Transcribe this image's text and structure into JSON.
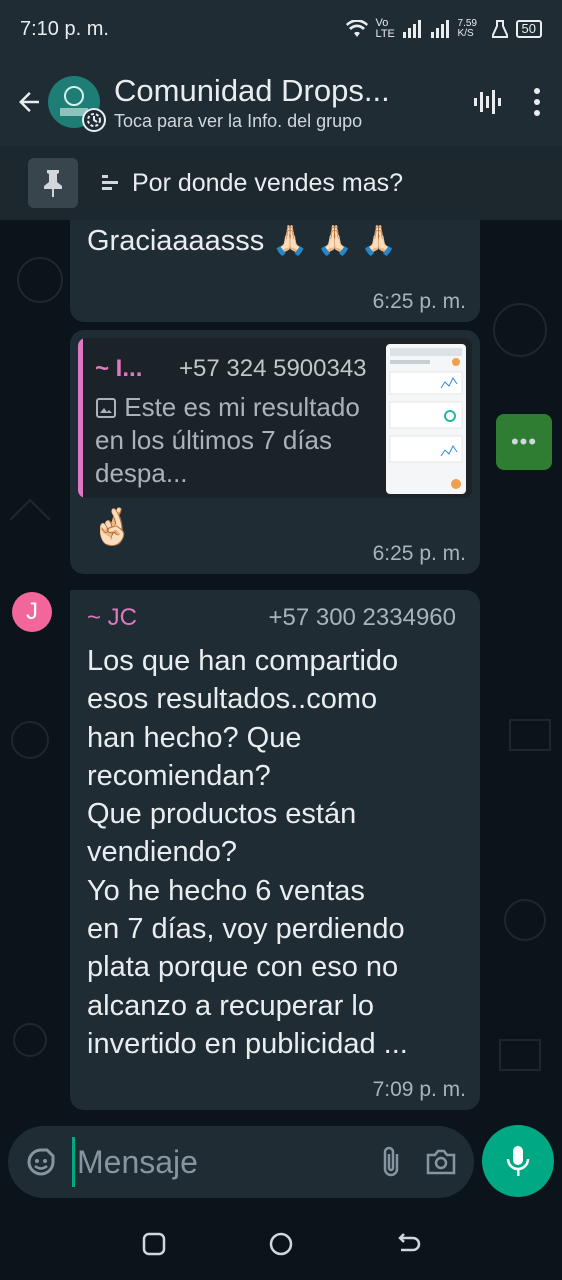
{
  "status_bar": {
    "time": "7:10 p. m.",
    "network": "Vo LTE",
    "speed": "7.59 K/S",
    "battery": "50"
  },
  "header": {
    "title": "Comunidad Drops...",
    "subtitle": "Toca para ver la Info. del grupo",
    "icons": [
      "back-arrow-icon",
      "group-avatar",
      "audio-wave-icon",
      "more-vertical-icon"
    ]
  },
  "pinned": {
    "text": "Por donde vendes mas?",
    "icon": "pin-icon",
    "type_icon": "poll-icon"
  },
  "messages": [
    {
      "text": "Graciaaaasss 🙏🏻 🙏🏻 🙏🏻",
      "time": "6:25 p. m."
    },
    {
      "quote_author": "~ I...",
      "quote_phone": "+57 324 5900343",
      "quote_text": "Este es mi resultado en los últimos 7 días despa...",
      "emoji": "🤞🏻",
      "time": "6:25 p. m."
    },
    {
      "avatar_letter": "J",
      "author": "~ JC",
      "phone": "+57 300 2334960",
      "text": "Los que han compartido\nesos resultados..como\nhan hecho? Que\nrecomiendan?\nQue productos están\nvendiendo?\nYo he hecho 6 ventas\nen 7 días, voy perdiendo\nplata porque con eso no\nalcanzo a recuperar lo\ninvertido en publicidad ...",
      "time": "7:09 p. m."
    }
  ],
  "composer": {
    "placeholder": "Mensaje",
    "icons": [
      "sticker-icon",
      "attach-icon",
      "camera-icon",
      "mic-icon"
    ]
  },
  "colors": {
    "accent": "#00a884",
    "bubble": "#202c33",
    "background": "#0b141a",
    "author_pink": "#df78c2"
  }
}
